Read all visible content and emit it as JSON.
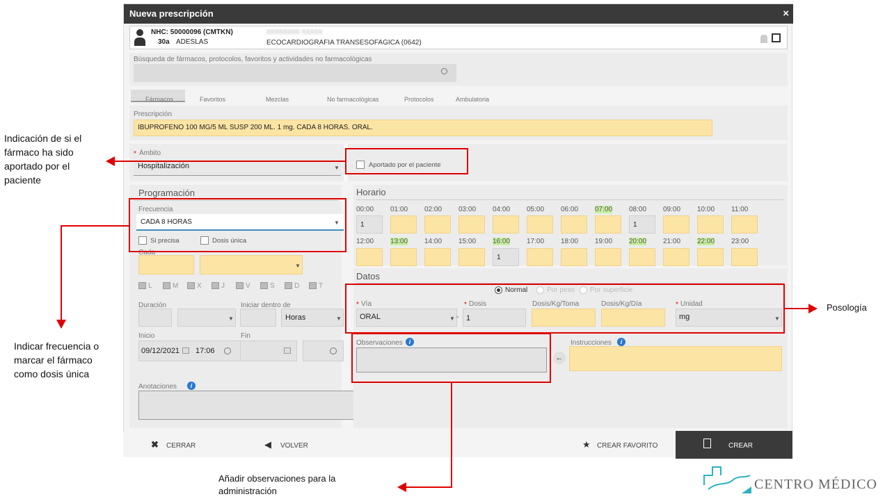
{
  "window": {
    "title": "Nueva prescripción",
    "close": "×"
  },
  "patient": {
    "nhc": "NHC: 50000096 (CMTKN)",
    "age": "30a",
    "insurer": "ADESLAS",
    "name": "XXXXXXXX XXXXX",
    "service": "ECOCARDIOGRAFIA TRANSESOFAGICA (0642)"
  },
  "search": {
    "label": "Búsqueda de fármacos, protocolos, favoritos y actividades no farmacológicas",
    "value": ""
  },
  "tabs": [
    "Fármacos",
    "Favoritos",
    "Mezclas",
    "No farmacológicas",
    "Protocolos",
    "Ambulatoria"
  ],
  "prescription": {
    "label": "Prescripción",
    "value": "IBUPROFENO 100 MG/5 ML SUSP 200 ML. 1 mg. CADA 8 HORAS. ORAL."
  },
  "ambito": {
    "label": "Ámbito",
    "value": "Hospitalización"
  },
  "aportado": {
    "label": "Aportado por el paciente"
  },
  "programacion": {
    "title": "Programación",
    "frecuencia_label": "Frecuencia",
    "frecuencia_value": "CADA 8 HORAS",
    "si_precisa": "Si precisa",
    "dosis_unica": "Dosis única",
    "cada": "Cada",
    "days": [
      "L",
      "M",
      "X",
      "J",
      "V",
      "S",
      "D",
      "T"
    ],
    "duracion": "Duración",
    "iniciar": "Iniciar dentro de",
    "horas": "Horas",
    "inicio": "Inicio",
    "fin": "Fin",
    "inicio_fecha": "09/12/2021",
    "inicio_hora": "17:06",
    "anotaciones": "Anotaciones"
  },
  "horario": {
    "title": "Horario",
    "row1": [
      "00:00",
      "01:00",
      "02:00",
      "03:00",
      "04:00",
      "05:00",
      "06:00",
      "07:00",
      "08:00",
      "09:00",
      "10:00",
      "11:00"
    ],
    "row2": [
      "12:00",
      "13:00",
      "14:00",
      "15:00",
      "16:00",
      "17:00",
      "18:00",
      "19:00",
      "20:00",
      "21:00",
      "22:00",
      "23:00"
    ],
    "dose": "1"
  },
  "datos": {
    "title": "Datos",
    "mode_normal": "Normal",
    "mode_peso": "Por peso",
    "mode_superficie": "Por superficie",
    "via_label": "Vía",
    "via_value": "ORAL",
    "dosis_label": "Dosis",
    "dosis_value": "1",
    "dkt_label": "Dosis/Kg/Toma",
    "dkd_label": "Dosis/Kg/Día",
    "unidad_label": "Unidad",
    "unidad_value": "mg",
    "observaciones": "Observaciones",
    "instrucciones": "Instrucciones"
  },
  "footer": {
    "cerrar": "CERRAR",
    "volver": "VOLVER",
    "favorito": "CREAR FAVORITO",
    "crear": "CREAR"
  },
  "annotations": {
    "aportado": "Indicación de si el fármaco ha sido aportado por el paciente",
    "frecuencia": "Indicar frecuencia o marcar el fármaco como dosis única",
    "posologia": "Posología",
    "observaciones": "Añadir observaciones para la administración"
  },
  "logo": {
    "text": "CENTRO MÉDICO"
  },
  "colors": {
    "accent": "#fce4a4",
    "highlight": "#c8f0a0",
    "annotation": "#e00000",
    "titlebar": "#3a3a3a"
  }
}
